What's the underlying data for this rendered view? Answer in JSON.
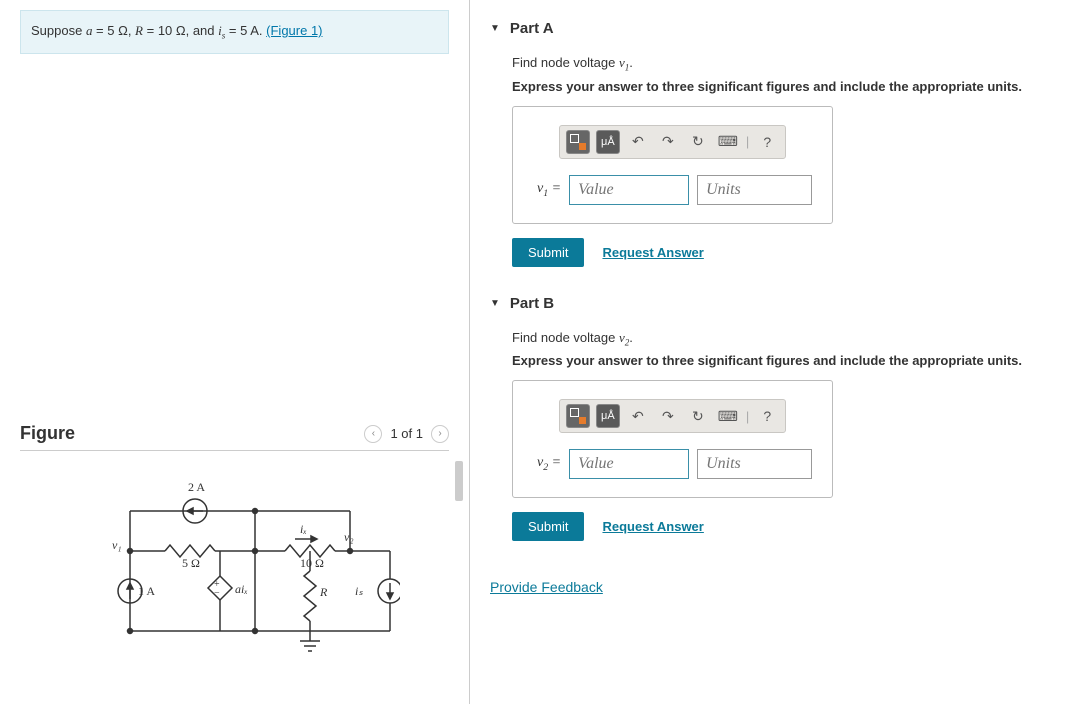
{
  "problem": {
    "prefix": "Suppose ",
    "eq1_lhs": "a",
    "eq1_rhs": " = 5 Ω, ",
    "eq2_lhs": "R",
    "eq2_rhs": " = 10 Ω, and ",
    "eq3_lhs": "i",
    "eq3_sub": "s",
    "eq3_rhs": " = 5 A. ",
    "figure_link": "(Figure 1)"
  },
  "figure": {
    "title": "Figure",
    "nav_text": "1 of 1",
    "labels": {
      "top_src": "2 A",
      "left_src": "1 A",
      "r1": "5 Ω",
      "r2": "10 Ω",
      "rR": "R",
      "v1": "v₁",
      "v2": "v₂",
      "ix": "iₓ",
      "aix": "aiₓ",
      "is": "iₛ"
    }
  },
  "parts": [
    {
      "title": "Part A",
      "find_prefix": "Find node voltage ",
      "find_var": "v",
      "find_sub": "1",
      "find_suffix": ".",
      "instruction": "Express your answer to three significant figures and include the appropriate units.",
      "var_label": "v",
      "var_sub": "1",
      "equals": " = ",
      "value_placeholder": "Value",
      "units_placeholder": "Units",
      "submit": "Submit",
      "request": "Request Answer",
      "toolbar_units": "μÅ"
    },
    {
      "title": "Part B",
      "find_prefix": "Find node voltage ",
      "find_var": "v",
      "find_sub": "2",
      "find_suffix": ".",
      "instruction": "Express your answer to three significant figures and include the appropriate units.",
      "var_label": "v",
      "var_sub": "2",
      "equals": " = ",
      "value_placeholder": "Value",
      "units_placeholder": "Units",
      "submit": "Submit",
      "request": "Request Answer",
      "toolbar_units": "μÅ"
    }
  ],
  "feedback": "Provide Feedback",
  "icons": {
    "undo": "↶",
    "redo": "↷",
    "reset": "↻",
    "keyboard": "⌨",
    "help": "?",
    "prev": "‹",
    "next": "›",
    "caret": "▼"
  }
}
